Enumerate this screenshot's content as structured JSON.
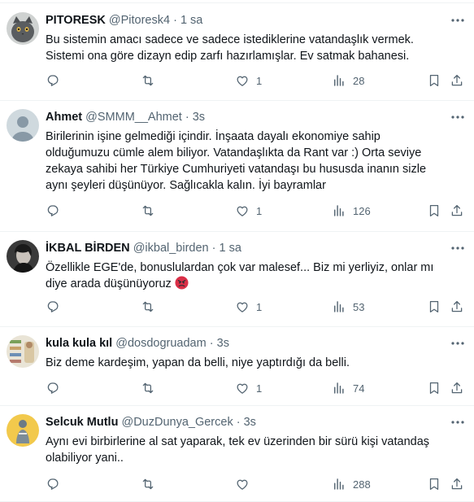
{
  "tweets": [
    {
      "name": "PITORESK",
      "handle": "@Pitoresk4",
      "dot": "·",
      "time": "1 sa",
      "lines": [
        "Bu sistemin amacı sadece ve sadece istediklerine vatandaşlık vermek.",
        "Sistemi ona göre dizayn edip zarfı hazırlamışlar. Ev satmak bahanesi."
      ],
      "replies": "",
      "retweets": "",
      "likes": "1",
      "views": "28"
    },
    {
      "name": "Ahmet",
      "handle": "@SMMM__Ahmet",
      "dot": "·",
      "time": "3s",
      "lines": [
        "Birilerinin işine gelmediği içindir. İnşaata dayalı ekonomiye sahip",
        "olduğumuzu cümle alem biliyor. Vatandaşlıkta da Rant var  :)  Orta seviye",
        "zekaya sahibi her Türkiye Cumhuriyeti vatandaşı bu hususda inanın sizle",
        "aynı şeyleri düşünüyor. Sağlıcakla kalın. İyi bayramlar"
      ],
      "replies": "",
      "retweets": "",
      "likes": "1",
      "views": "126"
    },
    {
      "name": "İKBAL BİRDEN",
      "handle": "@ikbal_birden",
      "dot": "·",
      "time": "1 sa",
      "lines": [
        "Özellikle EGE'de, bonuslulardan çok var malesef... Biz mi yerliyiz, onlar mı",
        "diye arada düşünüyoruz"
      ],
      "emoji": "angry-face",
      "replies": "",
      "retweets": "",
      "likes": "1",
      "views": "53"
    },
    {
      "name": "kula kula kıl",
      "handle": "@dosdogruadam",
      "dot": "·",
      "time": "3s",
      "lines": [
        "Biz deme kardeşim, yapan da belli, niye yaptırdığı da belli."
      ],
      "replies": "",
      "retweets": "",
      "likes": "1",
      "views": "74"
    },
    {
      "name": "Selcuk Mutlu",
      "handle": "@DuzDunya_Gercek",
      "dot": "·",
      "time": "3s",
      "lines": [
        "Aynı evi birbirlerine al sat yaparak, tek ev üzerinden bir sürü kişi vatandaş",
        "olabiliyor yani.."
      ],
      "replies": "",
      "retweets": "",
      "likes": "",
      "views": "288"
    }
  ],
  "colors": {
    "text": "#0f1419",
    "muted": "#536471",
    "border": "#eff3f4"
  }
}
